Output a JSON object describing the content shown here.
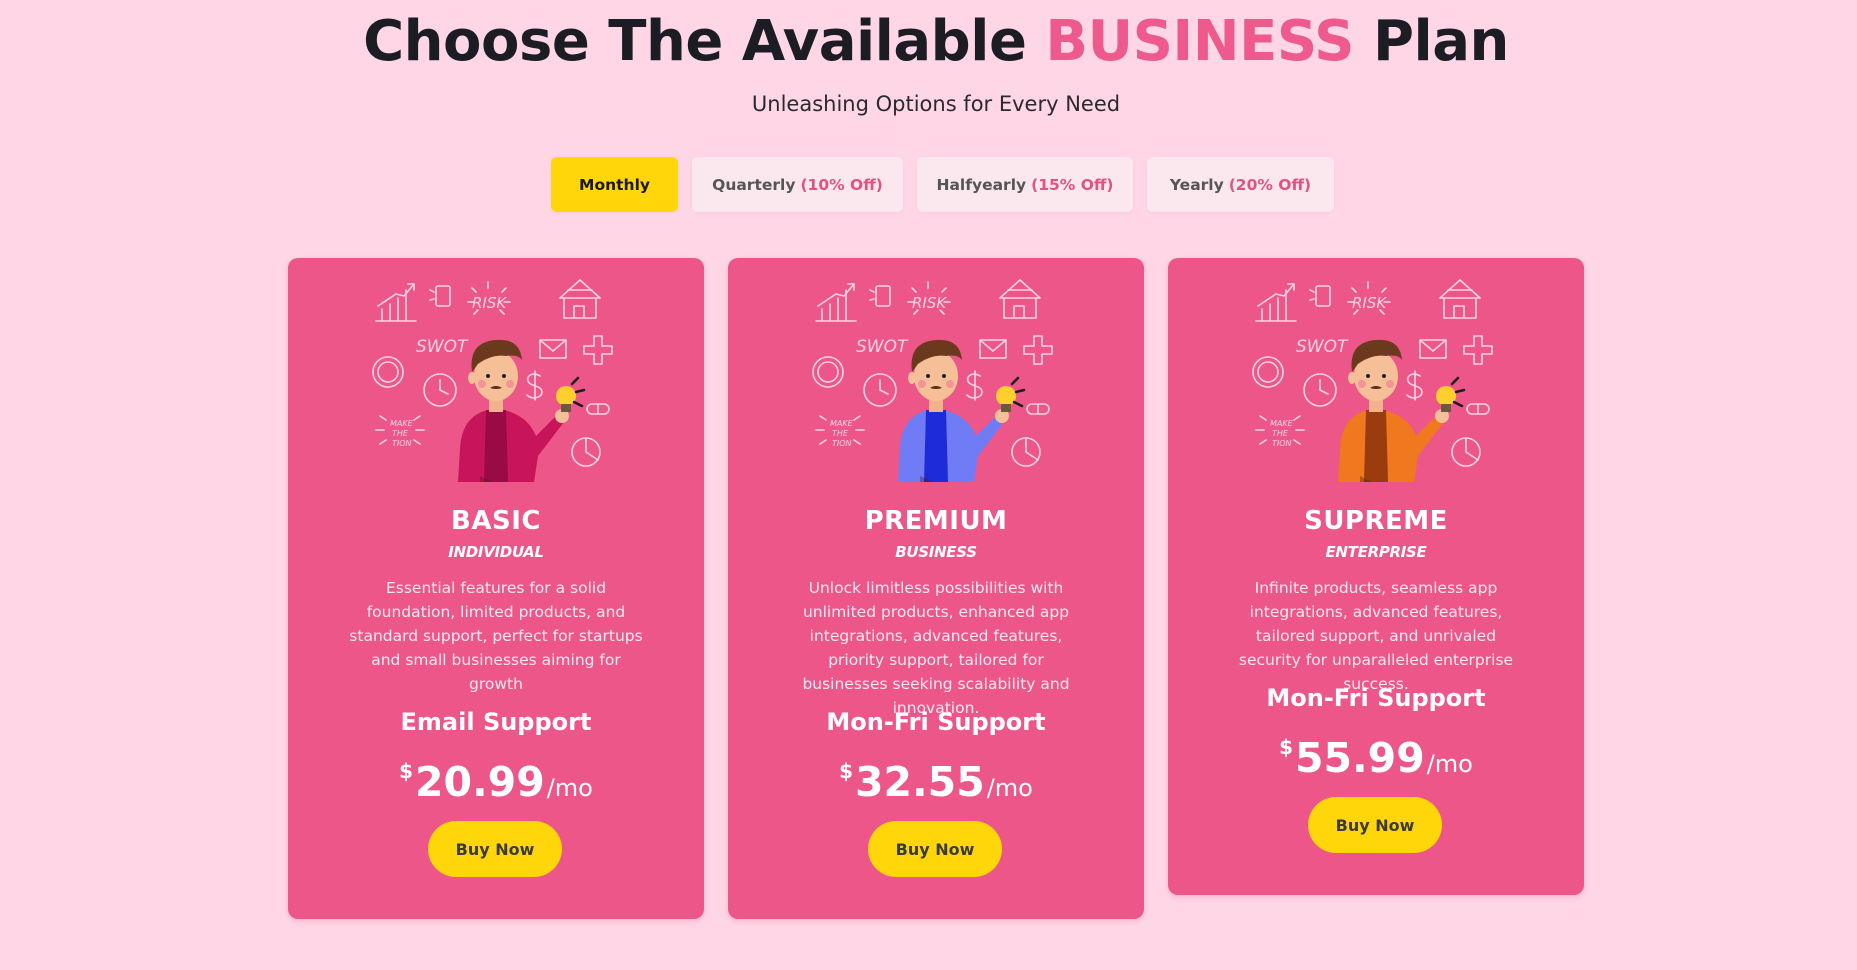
{
  "header": {
    "title_prefix": "Choose The Available",
    "title_accent": "BUSINESS",
    "title_suffix": "Plan",
    "subtitle": "Unleashing Options for Every Need"
  },
  "billing_tabs": [
    {
      "label": "Monthly",
      "discount": "",
      "active": true
    },
    {
      "label": "Quarterly",
      "discount": "(10% Off)",
      "active": false
    },
    {
      "label": "Halfyearly",
      "discount": "(15% Off)",
      "active": false
    },
    {
      "label": "Yearly",
      "discount": "(20% Off)",
      "active": false
    }
  ],
  "plans": [
    {
      "name": "BASIC",
      "tier": "INDIVIDUAL",
      "description": "Essential features for a solid foundation, limited products, and standard support, perfect for startups and small businesses aiming for growth",
      "support": "Email Support",
      "currency": "$",
      "price": "20.99",
      "period": "/mo",
      "cta": "Buy Now"
    },
    {
      "name": "PREMIUM",
      "tier": "BUSINESS",
      "description": "Unlock limitless possibilities with unlimited products, enhanced app integrations, advanced features, priority support, tailored for businesses seeking scalability and innovation.",
      "support": "Mon-Fri Support",
      "currency": "$",
      "price": "32.55",
      "period": "/mo",
      "cta": "Buy Now"
    },
    {
      "name": "SUPREME",
      "tier": "ENTERPRISE",
      "description": "Infinite products, seamless app integrations, advanced features, tailored support, and unrivaled security for unparalleled enterprise success.",
      "support": "Mon-Fri Support",
      "currency": "$",
      "price": "55.99",
      "period": "/mo",
      "cta": "Buy Now"
    }
  ],
  "illustration": {
    "doodle_words": [
      "RISK",
      "SWOT",
      "MAKE",
      "THE",
      "TION"
    ],
    "shirt_colors": [
      "#c8155a",
      "#6f7cf5",
      "#f0781e"
    ],
    "inner_shirt_colors": [
      "#9a0a45",
      "#1d2bd8",
      "#9b3c0e"
    ]
  },
  "colors": {
    "background": "#ffd6e6",
    "card": "#ed5688",
    "accent_text": "#ee5a8b",
    "button": "#ffd60a"
  }
}
